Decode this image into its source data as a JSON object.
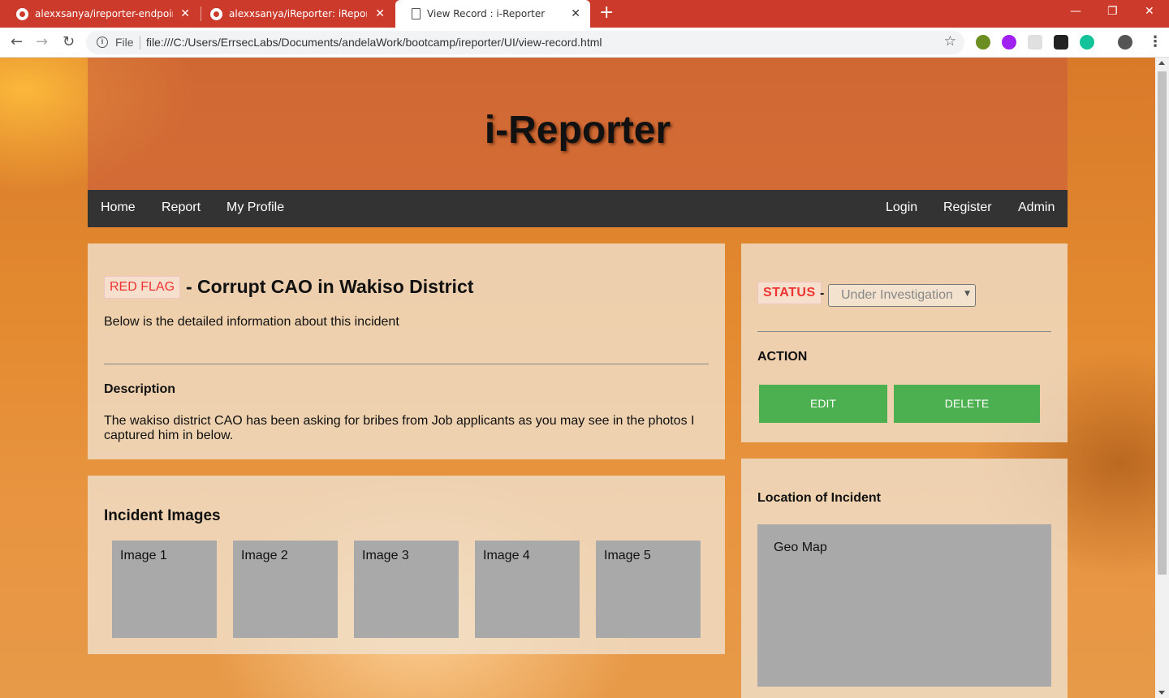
{
  "browser": {
    "tabs": [
      {
        "title": "alexxsanya/ireporter-endpoints a",
        "icon": "github-icon"
      },
      {
        "title": "alexxsanya/iReporter: iReporter e",
        "icon": "github-icon"
      },
      {
        "title": "View Record : i-Reporter",
        "icon": "document-icon"
      }
    ],
    "address": {
      "scheme_label": "File",
      "url": "file:///C:/Users/ErrsecLabs/Documents/andelaWork/bootcamp/ireporter/UI/view-record.html"
    }
  },
  "site": {
    "title": "i-Reporter"
  },
  "nav": {
    "left": [
      "Home",
      "Report",
      "My Profile"
    ],
    "right": [
      "Login",
      "Register",
      "Admin"
    ]
  },
  "record": {
    "tag": "RED FLAG",
    "title": "- Corrupt CAO in Wakiso District",
    "subtitle": "Below is the detailed information about this incident",
    "description_heading": "Description",
    "description": "The wakiso district CAO has been asking for bribes from Job applicants as you may see in the photos I captured him in below."
  },
  "status": {
    "label": "STATUS",
    "separator": "-",
    "selected": "Under Investigation"
  },
  "actions": {
    "heading": "ACTION",
    "edit": "EDIT",
    "delete": "DELETE"
  },
  "images": {
    "heading": "Incident Images",
    "items": [
      "Image 1",
      "Image 2",
      "Image 3",
      "Image 4",
      "Image 5"
    ]
  },
  "location": {
    "heading": "Location of Incident",
    "map_label": "Geo Map"
  },
  "colors": {
    "tabbar": "#cc3a2c",
    "navbar": "#333333",
    "tag_red": "#e33333",
    "button_green": "#4caf50",
    "placeholder_gray": "#a9a9a9"
  }
}
